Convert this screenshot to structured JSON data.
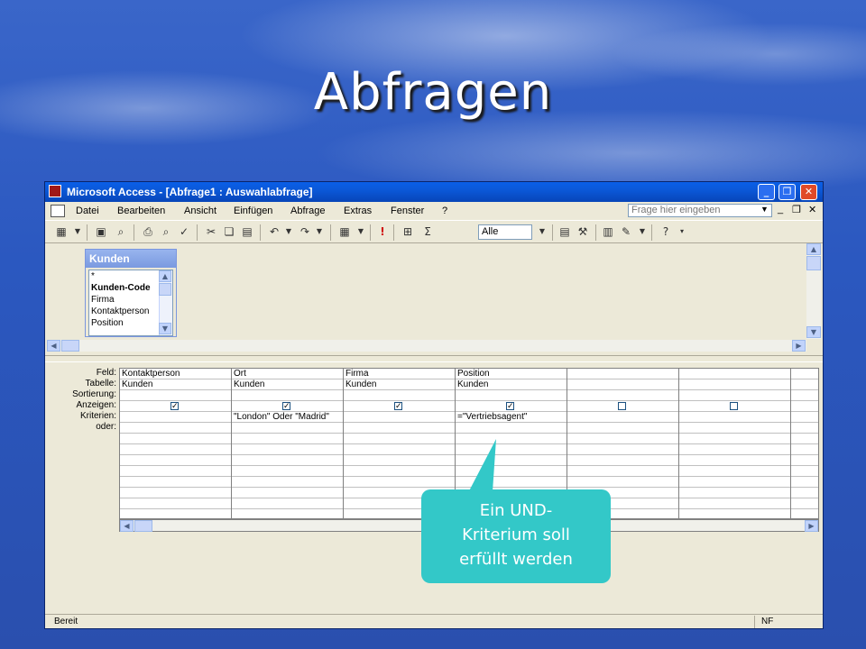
{
  "slide": {
    "title": "Abfragen",
    "callout": [
      "Ein UND-",
      "Kriterium soll",
      "erfüllt werden"
    ]
  },
  "window": {
    "title": "Microsoft Access - [Abfrage1 : Auswahlabfrage]",
    "controls": {
      "minimize": "_",
      "maximize": "❐",
      "close": "✕"
    }
  },
  "menu": {
    "items": [
      "Datei",
      "Bearbeiten",
      "Ansicht",
      "Einfügen",
      "Abfrage",
      "Extras",
      "Fenster",
      "?"
    ],
    "help_placeholder": "Frage hier eingeben"
  },
  "toolbar": {
    "top_values": "Alle",
    "icons": [
      "view-icon",
      "save-icon",
      "print-icon",
      "cut-icon",
      "copy-icon",
      "paste-icon",
      "undo-icon",
      "redo-icon",
      "query-type-icon",
      "run-icon",
      "show-table-icon",
      "totals-icon",
      "properties-icon",
      "build-icon",
      "database-window-icon",
      "new-object-icon",
      "help-icon"
    ]
  },
  "table_box": {
    "title": "Kunden",
    "fields": [
      "*",
      "Kunden-Code",
      "Firma",
      "Kontaktperson",
      "Position"
    ]
  },
  "grid": {
    "row_labels": [
      "Feld:",
      "Tabelle:",
      "Sortierung:",
      "Anzeigen:",
      "Kriterien:",
      "oder:"
    ],
    "columns": [
      {
        "feld": "Kontaktperson",
        "tabelle": "Kunden",
        "sortierung": "",
        "anzeigen": true,
        "kriterien": "",
        "oder": ""
      },
      {
        "feld": "Ort",
        "tabelle": "Kunden",
        "sortierung": "",
        "anzeigen": true,
        "kriterien": "\"London\" Oder \"Madrid\"",
        "oder": ""
      },
      {
        "feld": "Firma",
        "tabelle": "Kunden",
        "sortierung": "",
        "anzeigen": true,
        "kriterien": "",
        "oder": ""
      },
      {
        "feld": "Position",
        "tabelle": "Kunden",
        "sortierung": "",
        "anzeigen": true,
        "kriterien": "=\"Vertriebsagent\"",
        "oder": ""
      },
      {
        "feld": "",
        "tabelle": "",
        "sortierung": "",
        "anzeigen": false,
        "kriterien": "",
        "oder": ""
      },
      {
        "feld": "",
        "tabelle": "",
        "sortierung": "",
        "anzeigen": false,
        "kriterien": "",
        "oder": ""
      }
    ]
  },
  "status": {
    "left": "Bereit",
    "right": "NF"
  }
}
